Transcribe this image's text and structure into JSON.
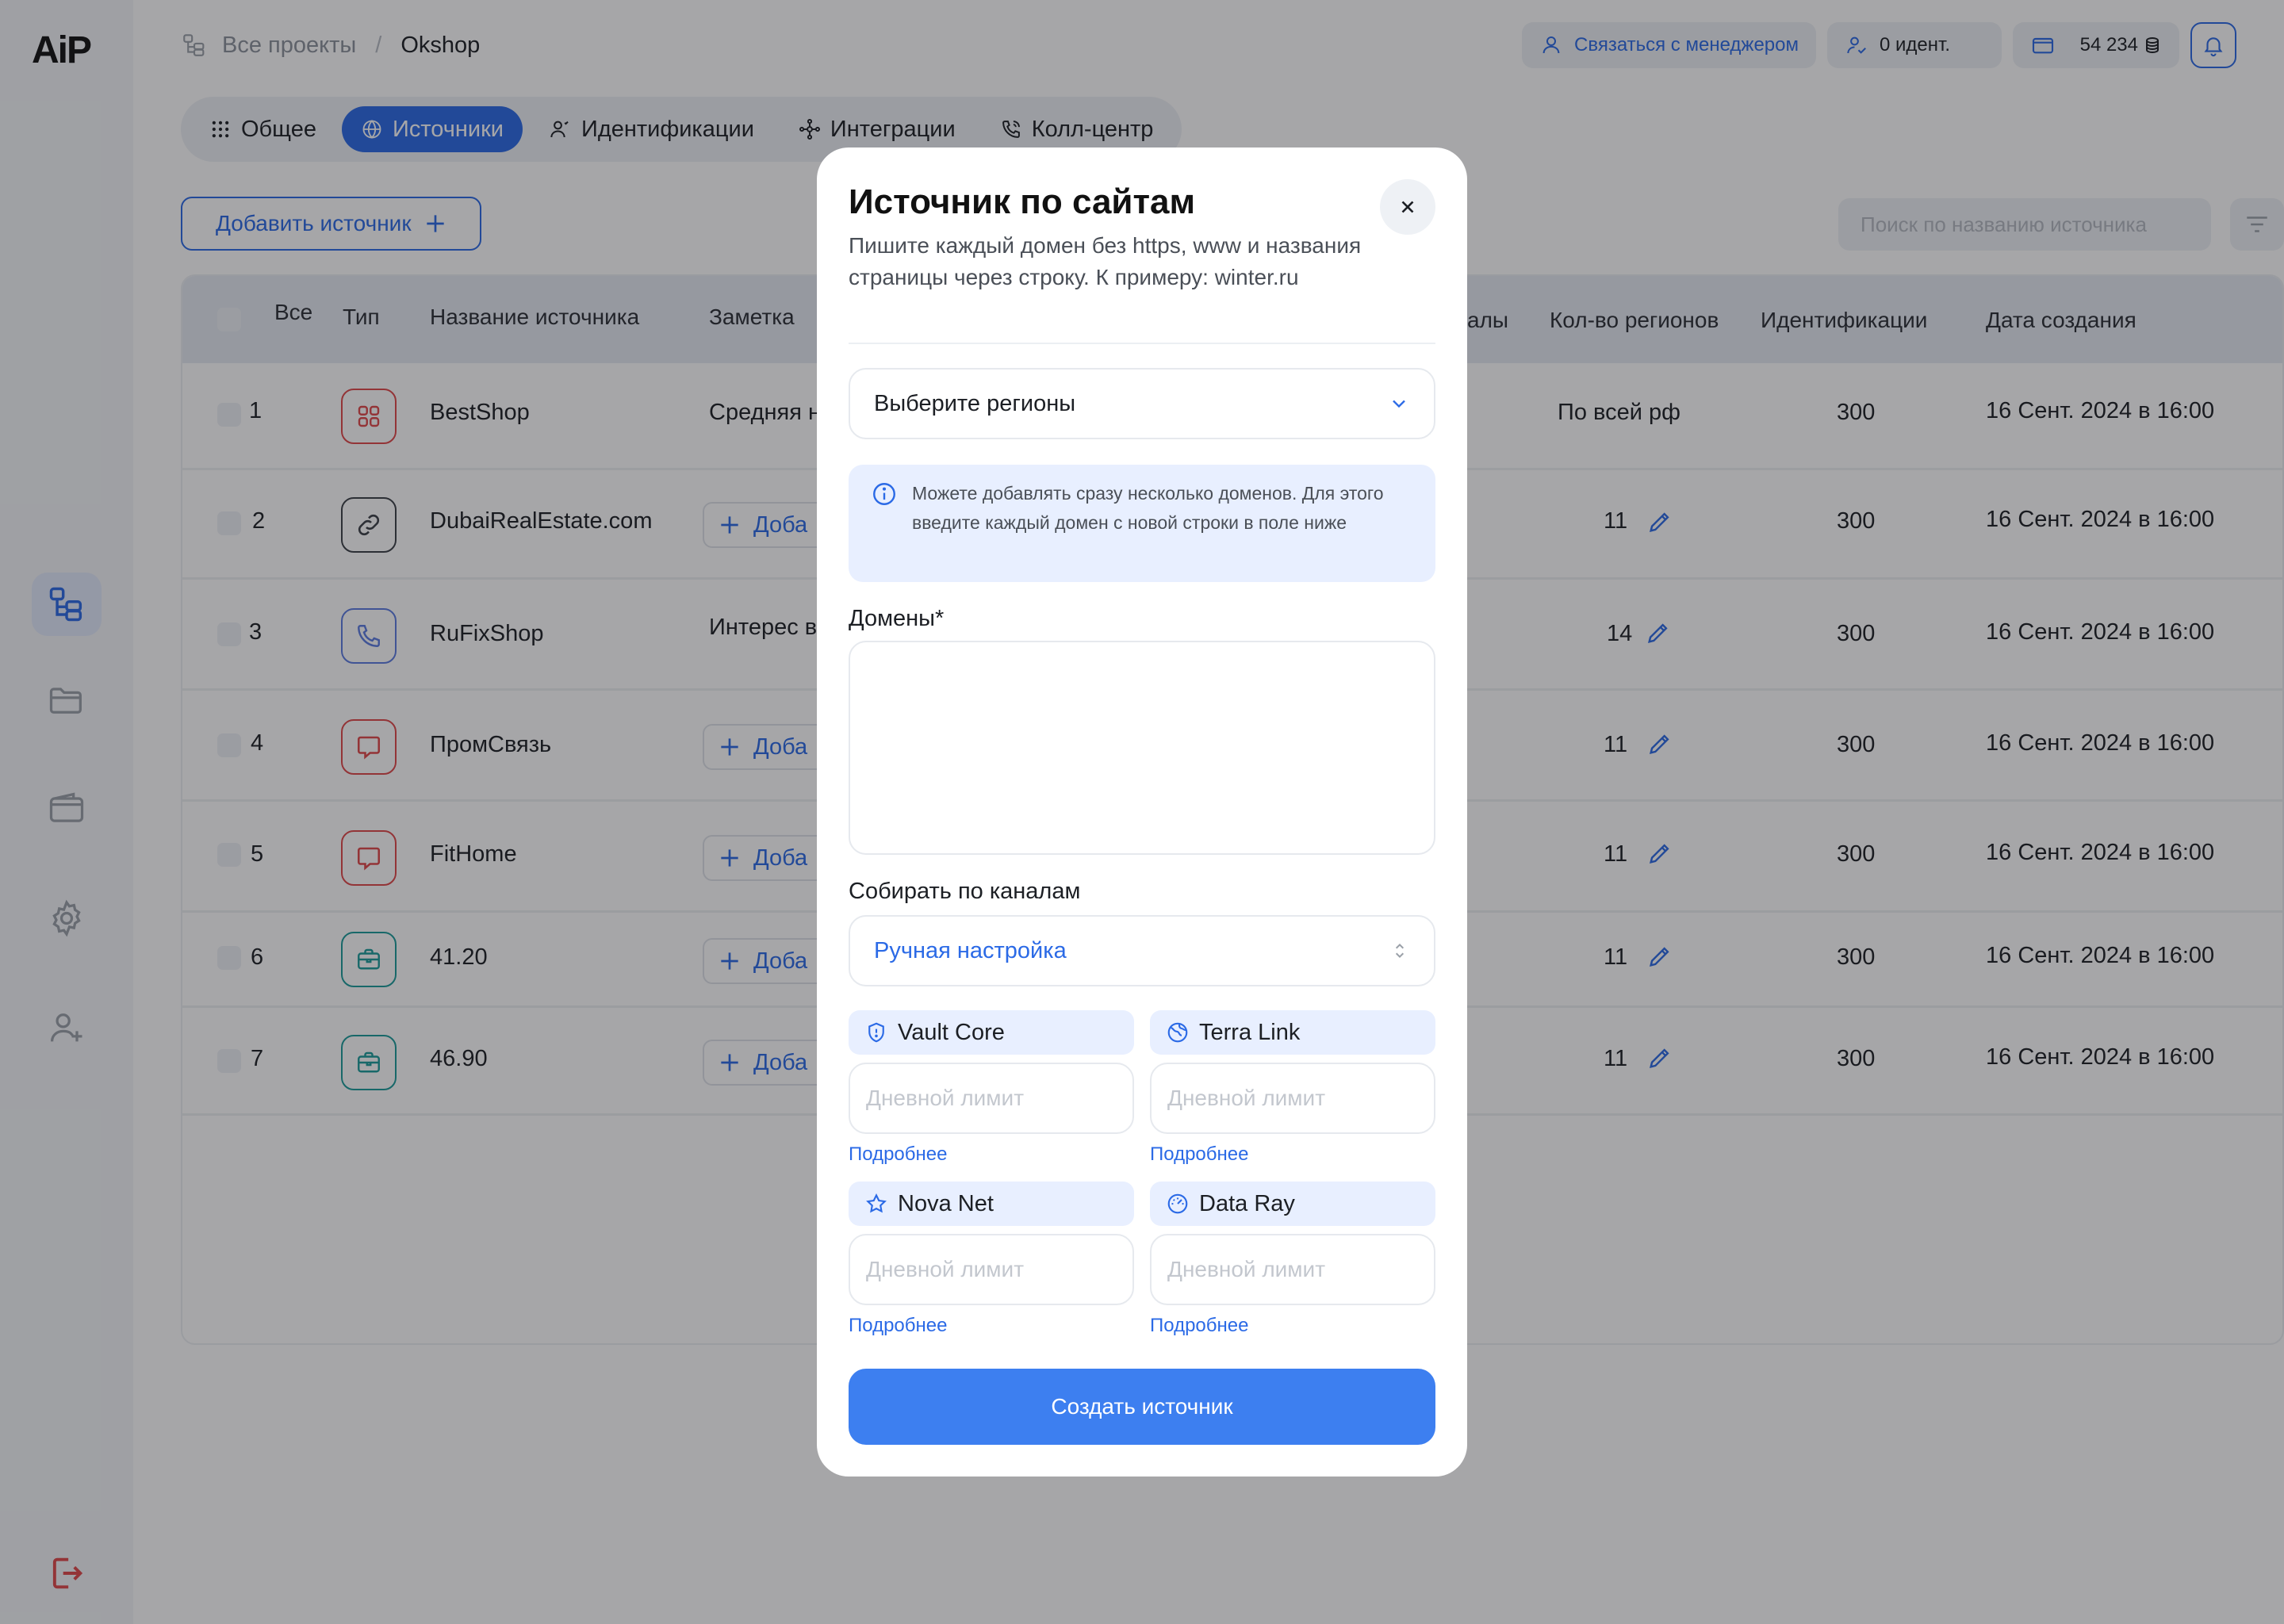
{
  "app": {
    "logo": "AiP"
  },
  "breadcrumb": {
    "root": "Все проекты",
    "separator": "/",
    "current": "Okshop"
  },
  "topbar": {
    "manager_label": "Связаться с менеджером",
    "identifications": "0 идент.",
    "balance": "54 234"
  },
  "tabs": [
    {
      "label": "Общее",
      "icon": "grid-icon"
    },
    {
      "label": "Источники",
      "icon": "globe-icon",
      "active": true
    },
    {
      "label": "Идентификации",
      "icon": "user-icon"
    },
    {
      "label": "Интеграции",
      "icon": "nodes-icon"
    },
    {
      "label": "Колл-центр",
      "icon": "phone-icon"
    }
  ],
  "toolbar": {
    "add_source_label": "Добавить источник",
    "search_placeholder": "Поиск по названию источника"
  },
  "table": {
    "headers": {
      "all": "Все",
      "type": "Тип",
      "name": "Название источника",
      "note": "Заметка",
      "channels": "алы",
      "regions": "Кол-во регионов",
      "identifications": "Идентификации",
      "created": "Дата создания"
    },
    "add_note_label": "Доба",
    "rows": [
      {
        "num": "1",
        "type": "grid-icon",
        "type_color": "#e0484a",
        "name": "BestShop",
        "note": "Средняя н",
        "regions": "По всей рф",
        "idents": "300",
        "date": "16 Сент. 2024 в 16:00"
      },
      {
        "num": "2",
        "type": "link-icon",
        "type_color": "#3b3f46",
        "name": "DubaiRealEstate.com",
        "note": "",
        "regions": "11",
        "idents": "300",
        "date": "16 Сент. 2024 в 16:00"
      },
      {
        "num": "3",
        "type": "phone-icon",
        "type_color": "#5b7be0",
        "name": "RuFixShop",
        "note": "Интерес в",
        "regions": "14",
        "idents": "300",
        "date": "16 Сент. 2024 в 16:00"
      },
      {
        "num": "4",
        "type": "chat-icon",
        "type_color": "#e0484a",
        "name": "ПромСвязь",
        "note": "",
        "regions": "11",
        "idents": "300",
        "date": "16 Сент. 2024 в 16:00"
      },
      {
        "num": "5",
        "type": "chat-icon",
        "type_color": "#e0484a",
        "name": "FitHome",
        "note": "",
        "regions": "11",
        "idents": "300",
        "date": "16 Сент. 2024 в 16:00"
      },
      {
        "num": "6",
        "type": "briefcase-icon",
        "type_color": "#1b9c9a",
        "name": "41.20",
        "note": "",
        "regions": "11",
        "idents": "300",
        "date": "16 Сент. 2024 в 16:00"
      },
      {
        "num": "7",
        "type": "briefcase-icon",
        "type_color": "#1b9c9a",
        "name": "46.90",
        "note": "",
        "regions": "11",
        "idents": "300",
        "date": "16 Сент. 2024 в 16:00"
      }
    ]
  },
  "modal": {
    "title": "Источник по сайтам",
    "description": "Пишите каждый домен без https, www и названия страницы через строку. К примеру: winter.ru",
    "regions_placeholder": "Выберите регионы",
    "info_text": "Можете добавлять сразу несколько доменов. Для этого введите каждый домен с новой строки в поле ниже",
    "domains_label": "Домены*",
    "domains_value": "",
    "channels_label": "Собирать по каналам",
    "channels_mode": "Ручная настройка",
    "limit_placeholder": "Дневной лимит",
    "more_label": "Подробнее",
    "channels": [
      {
        "name": "Vault Core",
        "icon": "shield-icon"
      },
      {
        "name": "Terra Link",
        "icon": "globe-icon"
      },
      {
        "name": "Nova Net",
        "icon": "star-icon"
      },
      {
        "name": "Data Ray",
        "icon": "gauge-icon"
      }
    ],
    "submit_label": "Создать источник"
  },
  "colors": {
    "accent": "#2b6ae6",
    "button": "#3d7ff0",
    "info_bg": "#e8efff",
    "danger": "#e0484a"
  }
}
